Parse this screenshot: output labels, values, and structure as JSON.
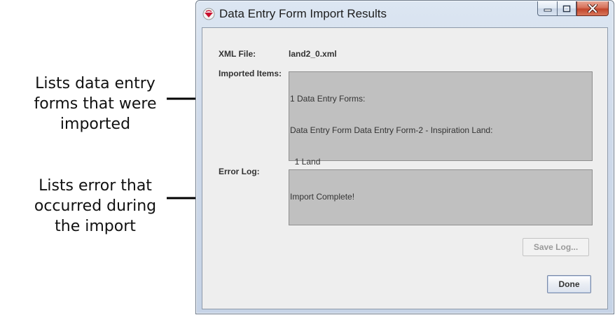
{
  "annotations": {
    "imported_callout": [
      "Lists data entry",
      "forms that were",
      "imported"
    ],
    "error_callout": [
      "Lists error that",
      "occurred during",
      "the import"
    ]
  },
  "window": {
    "title": "Data Entry Form Import Results",
    "icons": {
      "app": "app-logo-icon",
      "minimize": "minimize-icon",
      "maximize": "maximize-icon",
      "close": "close-icon"
    },
    "colors": {
      "client_bg": "#eeeeee",
      "textarea_bg": "#c0c0c0",
      "close_button": "#c2452b"
    }
  },
  "form": {
    "xml_file_label": "XML File:",
    "xml_file_value": "land2_0.xml",
    "imported_items_label": "Imported Items:",
    "imported_items_lines": [
      "1 Data Entry Forms:",
      "Data Entry Form Data Entry Form-2 - Inspiration Land:",
      "  1 Land"
    ],
    "error_log_label": "Error Log:",
    "error_log_lines": [
      "Import Complete!"
    ]
  },
  "buttons": {
    "save_log": "Save Log...",
    "done": "Done"
  }
}
